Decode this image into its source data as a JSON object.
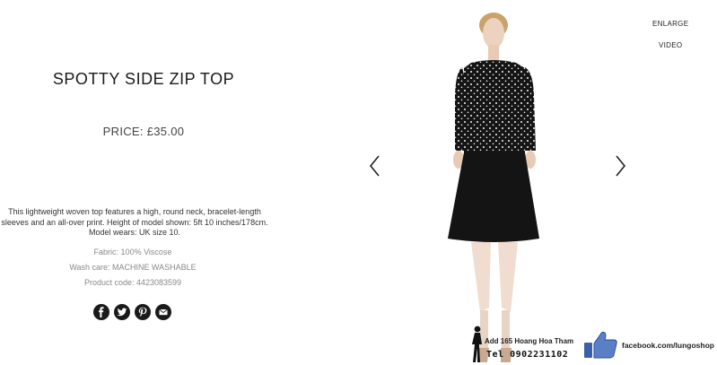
{
  "product": {
    "title": "SPOTTY SIDE ZIP TOP",
    "price_label": "PRICE:",
    "price_value": "£35.00",
    "description": "This lightweight woven top features a high, round neck, bracelet-length sleeves and an all-over print. Height of model shown: 5ft 10 inches/178cm. Model wears: UK size 10.",
    "fabric": "Fabric: 100% Viscose",
    "wash_care": "Wash care: MACHINE WASHABLE",
    "product_code": "Product code: 4423083599"
  },
  "media_links": {
    "enlarge": "ENLARGE",
    "video": "VIDEO"
  },
  "share_icons": [
    "facebook-icon",
    "twitter-icon",
    "pinterest-icon",
    "email-icon"
  ],
  "gallery": {
    "prev_icon": "chevron-left-icon",
    "next_icon": "chevron-right-icon"
  },
  "watermark": {
    "address": "Add 165 Hoang Hoa Tham",
    "phone": "Tel 0902231102",
    "facebook": "facebook.com/lungoshop"
  },
  "colors": {
    "text": "#1a1a1a",
    "muted": "#8a8a8a",
    "like_blue": "#3b5fa8"
  }
}
